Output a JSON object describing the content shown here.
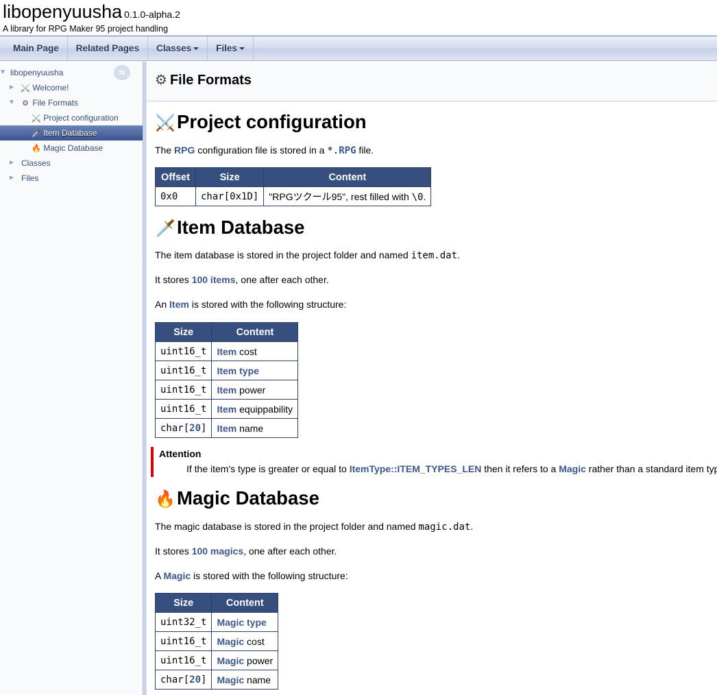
{
  "header": {
    "project_name": "libopenyuusha",
    "project_number": "0.1.0-alpha.2",
    "project_brief": "A library for RPG Maker 95 project handling"
  },
  "menu": [
    {
      "label": "Main Page",
      "dropdown": false
    },
    {
      "label": "Related Pages",
      "dropdown": false
    },
    {
      "label": "Classes",
      "dropdown": true
    },
    {
      "label": "Files",
      "dropdown": true
    }
  ],
  "nav": {
    "root": "libopenyuusha",
    "items": [
      {
        "label": "Welcome!",
        "icon": "crossed-swords-icon",
        "glyph": "⚔️"
      },
      {
        "label": "File Formats",
        "icon": "gear-icon",
        "glyph": "⚙"
      },
      {
        "label": "Project configuration",
        "icon": "crossed-swords-icon",
        "glyph": "⚔️"
      },
      {
        "label": "Item Database",
        "icon": "dagger-icon",
        "glyph": "🗡️"
      },
      {
        "label": "Magic Database",
        "icon": "fire-icon",
        "glyph": "🔥"
      },
      {
        "label": "Classes"
      },
      {
        "label": "Files"
      }
    ]
  },
  "page": {
    "title": "File Formats",
    "project_config": {
      "heading": "Project configuration",
      "emoji": "⚔️",
      "p_pre": "The ",
      "p_link": "RPG",
      "p_mid": " configuration file is stored in a ",
      "p_code1": "*.",
      "p_code_link": "RPG",
      "p_post": " file.",
      "table": {
        "headers": [
          "Offset",
          "Size",
          "Content"
        ],
        "row": {
          "offset": "0x0",
          "size": "char[0x1D]",
          "content_pre": "\"RPGツクール95\", rest filled with ",
          "content_code": "\\0",
          "content_post": "."
        }
      }
    },
    "item_db": {
      "heading": "Item Database",
      "emoji": "🗡️",
      "p1_pre": "The item database is stored in the project folder and named ",
      "p1_code": "item.dat",
      "p1_post": ".",
      "p2_pre": "It stores ",
      "p2_link": "100 items",
      "p2_post": ", one after each other.",
      "p3_pre": "An ",
      "p3_link": "Item",
      "p3_post": " is stored with the following structure:",
      "table": {
        "headers": [
          "Size",
          "Content"
        ],
        "rows": [
          {
            "size": "uint16_t",
            "link": "Item",
            "text": " cost"
          },
          {
            "size": "uint16_t",
            "link": "Item type",
            "text": ""
          },
          {
            "size": "uint16_t",
            "link": "Item",
            "text": " power"
          },
          {
            "size": "uint16_t",
            "link": "Item",
            "text": " equippability"
          },
          {
            "size_pre": "char[",
            "size_link": "20",
            "size_post": "]",
            "link": "Item",
            "text": " name"
          }
        ]
      },
      "attention": {
        "title": "Attention",
        "pre": "If the item's type is greater or equal to ",
        "link1": "ItemType::ITEM_TYPES_LEN",
        "mid": " then it refers to a ",
        "link2": "Magic",
        "post": " rather than a standard item type."
      }
    },
    "magic_db": {
      "heading": "Magic Database",
      "emoji": "🔥",
      "p1_pre": "The magic database is stored in the project folder and named ",
      "p1_code": "magic.dat",
      "p1_post": ".",
      "p2_pre": "It stores ",
      "p2_link": "100 magics",
      "p2_post": ", one after each other.",
      "p3_pre": "A ",
      "p3_link": "Magic",
      "p3_post": " is stored with the following structure:",
      "table": {
        "headers": [
          "Size",
          "Content"
        ],
        "rows": [
          {
            "size": "uint32_t",
            "link": "Magic type",
            "text": ""
          },
          {
            "size": "uint16_t",
            "link": "Magic",
            "text": " cost"
          },
          {
            "size": "uint16_t",
            "link": "Magic",
            "text": " power"
          },
          {
            "size_pre": "char[",
            "size_link": "20",
            "size_post": "]",
            "link": "Magic",
            "text": " name"
          }
        ]
      }
    }
  },
  "colors": {
    "link": "#3d578c",
    "table_header": "#374f7f",
    "attention_bar": "#e00000",
    "nav_selected": "#3b5590"
  }
}
